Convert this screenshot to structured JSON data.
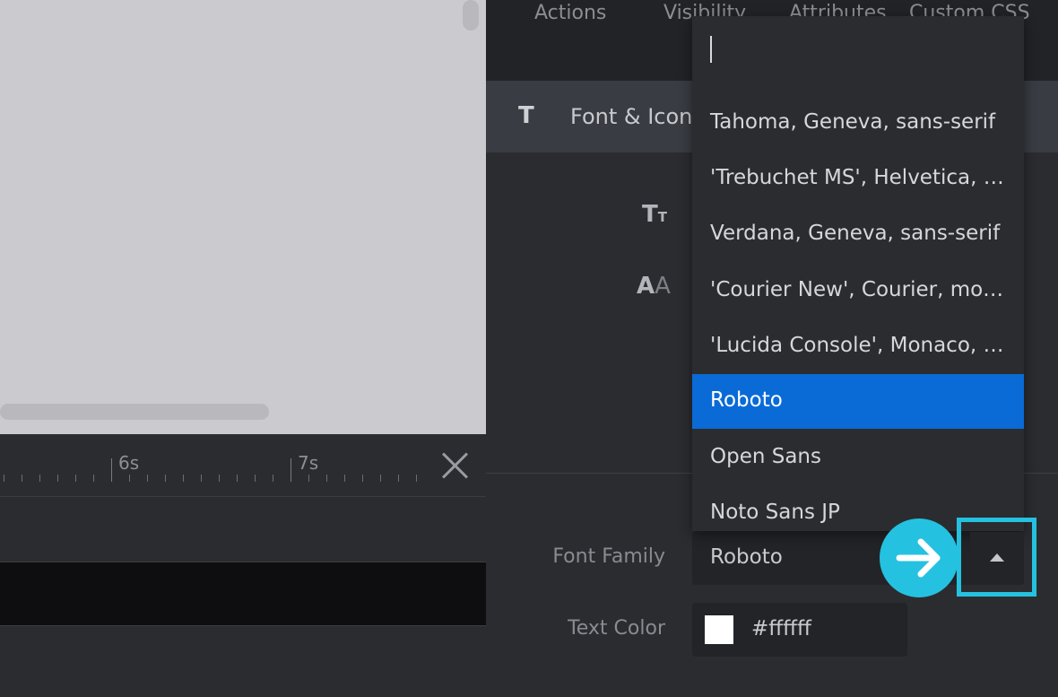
{
  "timeline": {
    "tick_labels": [
      "6s",
      "7s"
    ]
  },
  "panel": {
    "tabs": [
      "Actions",
      "Visibility",
      "Attributes",
      "Custom CSS"
    ],
    "section_icon": "T",
    "section_title": "Font & Icon",
    "font_size_icon": "text-size-icon",
    "letter_case_icon": "letter-case-icon",
    "font_family_label": "Font Family",
    "font_family_value": "Roboto",
    "text_color_label": "Text Color",
    "text_color_value": "#ffffff"
  },
  "dropdown": {
    "search_value": "",
    "options": [
      "Tahoma, Geneva, sans-serif",
      "'Trebuchet MS', Helvetica, sans-serif",
      "Verdana, Geneva, sans-serif",
      "'Courier New', Courier, monospace",
      "'Lucida Console', Monaco, monospace",
      "Roboto",
      "Open Sans",
      "Noto Sans JP"
    ],
    "selected": "Roboto"
  },
  "colors": {
    "accent_highlight": "#25c1e0",
    "selected_option": "#0a6bd6"
  }
}
